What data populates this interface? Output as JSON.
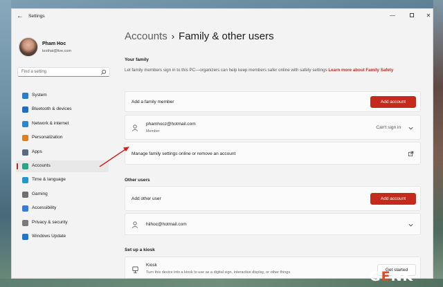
{
  "app": {
    "title": "Settings"
  },
  "user": {
    "name": "Pham Hoc",
    "email": "texthai@live.com"
  },
  "search": {
    "placeholder": "Find a setting"
  },
  "nav": [
    {
      "label": "System",
      "icon": "monitor-icon",
      "color": "#2a7ec8"
    },
    {
      "label": "Bluetooth & devices",
      "icon": "bluetooth-icon",
      "color": "#1d6fc1"
    },
    {
      "label": "Network & internet",
      "icon": "wifi-icon",
      "color": "#2b86d0"
    },
    {
      "label": "Personalization",
      "icon": "brush-icon",
      "color": "#d9822b"
    },
    {
      "label": "Apps",
      "icon": "apps-icon",
      "color": "#5a6a80"
    },
    {
      "label": "Accounts",
      "icon": "person-icon",
      "color": "#2aa58a",
      "active": true
    },
    {
      "label": "Time & language",
      "icon": "globe-clock-icon",
      "color": "#2496c9"
    },
    {
      "label": "Gaming",
      "icon": "gamepad-icon",
      "color": "#6f6f6f"
    },
    {
      "label": "Accessibility",
      "icon": "accessibility-icon",
      "color": "#3a7bd5"
    },
    {
      "label": "Privacy & security",
      "icon": "shield-icon",
      "color": "#7a7a7a"
    },
    {
      "label": "Windows Update",
      "icon": "update-icon",
      "color": "#1e78c8"
    }
  ],
  "breadcrumb": {
    "root": "Accounts",
    "separator": "›",
    "current": "Family & other users"
  },
  "family": {
    "title": "Your family",
    "description": "Let family members sign in to this PC—organizers can help keep members safer online with safety settings",
    "link": "Learn more about Family Safety",
    "add_label": "Add a family member",
    "add_button": "Add account",
    "member_email": "phamhocz@hotmail.com",
    "member_role": "Member",
    "member_status": "Can't sign in",
    "manage_label": "Manage family settings online or remove an account"
  },
  "other": {
    "title": "Other users",
    "add_label": "Add other user",
    "add_button": "Add account",
    "user_email": "hiihoc@hotmail.com"
  },
  "kiosk": {
    "title": "Set up a kiosk",
    "name": "Kiosk",
    "description": "Turn this device into a kiosk to use as a digital sign, interactive display, or other things",
    "button": "Get started"
  },
  "watermark": {
    "prefix": "G",
    "accent": "E",
    "suffix": "NK"
  },
  "colors": {
    "accent": "#c42b1c",
    "background": "#f3f3f3"
  }
}
